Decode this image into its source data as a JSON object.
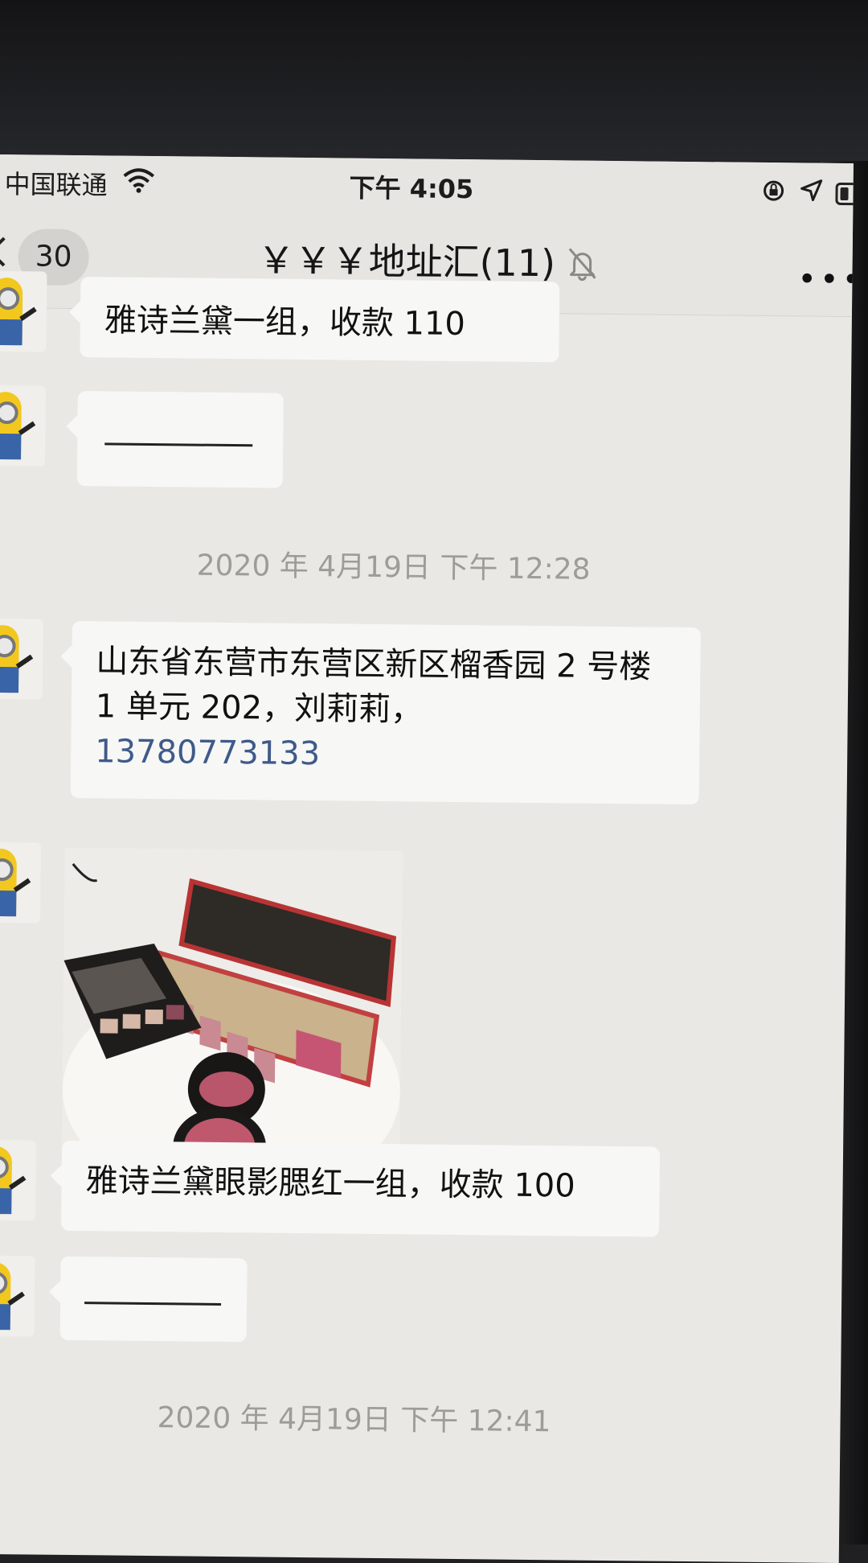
{
  "status_bar": {
    "carrier": "中国联通",
    "time": "下午 4:05"
  },
  "nav": {
    "unread_count": "30",
    "title": "￥￥￥地址汇(11)"
  },
  "messages": {
    "partial_top": "雅诗兰黛一组，收款 110",
    "timestamp_1": "2020 年 4月19日 下午 12:28",
    "address_text": "山东省东营市东营区新区榴香园 2 号楼 1 单元 202，刘莉莉，",
    "phone": "13780773133",
    "product_caption": "雅诗兰黛眼影腮红一组，收款 100",
    "timestamp_2": "2020 年 4月19日 下午 12:41"
  },
  "colors": {
    "screen_bg": "#e9e8e4",
    "bubble_bg": "#f7f7f6",
    "link": "#3f5a8a",
    "timestamp": "#9d9c99"
  },
  "icons": [
    "back-icon",
    "wifi-icon",
    "rotation-lock-icon",
    "location-icon",
    "battery-icon",
    "mute-bell-icon",
    "more-icon",
    "minion-avatar"
  ]
}
